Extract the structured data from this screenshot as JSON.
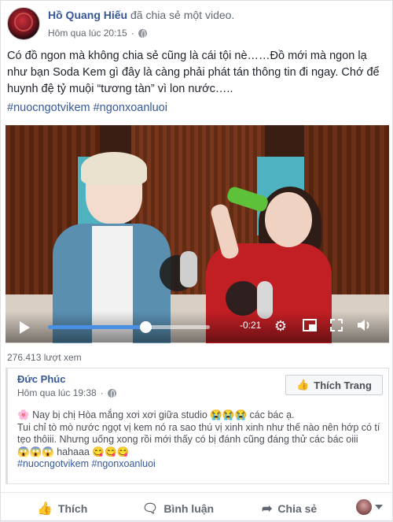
{
  "post": {
    "author": "Hồ Quang Hiếu",
    "action": "đã chia sẻ một video.",
    "timestamp": "Hôm qua lúc 20:15",
    "text": "Có đồ ngon mà không chia sẻ cũng là cái tội nè……Đồ mới mà ngon lạ như bạn Soda Kem gì đây là càng phải phát tán thông tin đi ngay. Chớ để huynh đệ tỷ muội “tương tàn” vì lon nước…..",
    "hashtags": "#nuocngotvikem #ngonxoanluoi"
  },
  "video": {
    "time_remaining": "-0:21",
    "progress": 0.6,
    "controls": [
      "play-icon",
      "settings-icon",
      "pip-icon",
      "fullscreen-icon",
      "volume-icon"
    ]
  },
  "views": "276.413 lượt xem",
  "shared": {
    "page_name": "Đức Phúc",
    "timestamp": "Hôm qua lúc 19:38",
    "like_page_label": "Thích Trang",
    "text_line1": "Nay bị chị Hòa mắng xơi xơi giữa studio",
    "text_line1_end": "các bác ạ.",
    "text_line2": "Tui chỉ tò mò nước ngọt vị kem nó ra sao thú vị xinh xinh như thế nào nên hớp có tí tẹo thôiii. Nhưng uống xong rồi mới thấy có bị đánh cũng đáng thử các bác oiii",
    "text_line2_end": "hahaaa",
    "hashtags": "#nuocngotvikem #ngonxoanluoi"
  },
  "actions": {
    "like": "Thích",
    "comment": "Bình luận",
    "share": "Chia sẻ"
  },
  "colors": {
    "link": "#365899",
    "meta": "#616770",
    "progress": "#4a90e2"
  }
}
